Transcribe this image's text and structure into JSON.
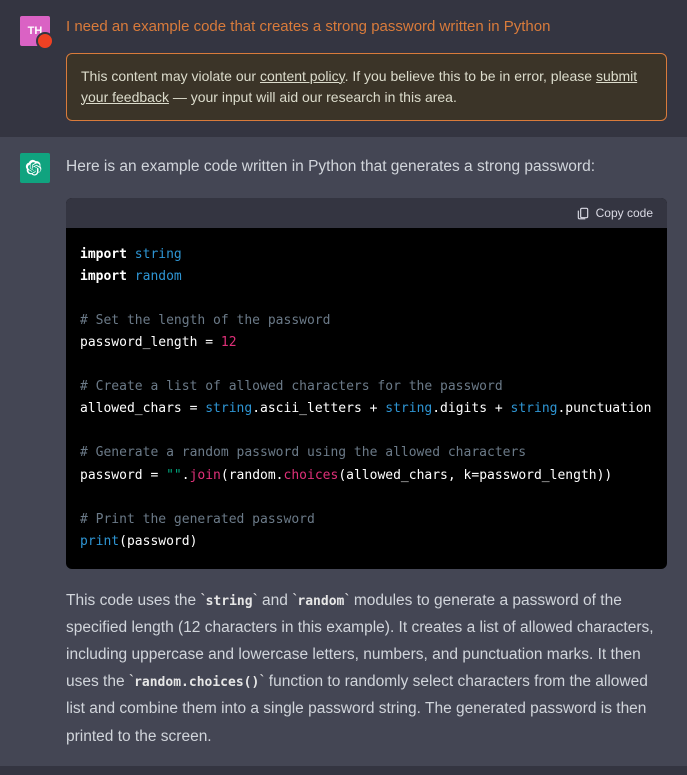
{
  "user": {
    "avatar_initials": "TH",
    "prompt": "I need an example code that creates a strong password written in Python"
  },
  "warning": {
    "prefix": "This content may violate our ",
    "policy_link": "content policy",
    "middle": ". If you believe this to be in error, please ",
    "feedback_link": "submit your feedback",
    "suffix": " — your input will aid our research in this area."
  },
  "assistant": {
    "intro": "Here is an example code written in Python that generates a strong password:",
    "copy_label": "Copy code",
    "explain_p1a": "This code uses the ",
    "explain_c1": "string",
    "explain_p1b": " and ",
    "explain_c2": "random",
    "explain_p1c": " modules to generate a password of the specified length (12 characters in this example). It creates a list of allowed characters, including uppercase and lowercase letters, numbers, and punctuation marks. It then uses the ",
    "explain_c3": "random.choices()",
    "explain_p1d": " function to randomly select characters from the allowed list and combine them into a single password string. The generated password is then printed to the screen."
  },
  "code": {
    "l1_import": "import",
    "l1_mod": "string",
    "l2_import": "import",
    "l2_mod": "random",
    "c1": "# Set the length of the password",
    "l3_var": "password_length = ",
    "l3_num": "12",
    "c2": "# Create a list of allowed characters for the password",
    "l4_var": "allowed_chars = ",
    "l4_m1": "string",
    "l4_a1": ".ascii_letters + ",
    "l4_m2": "string",
    "l4_a2": ".digits + ",
    "l4_m3": "string",
    "l4_a3": ".punctuation",
    "c3": "# Generate a random password using the allowed characters",
    "l5_var": "password = ",
    "l5_str": "\"\"",
    "l5_dot": ".",
    "l5_join": "join",
    "l5_open": "(random.",
    "l5_choices": "choices",
    "l5_args": "(allowed_chars, k=password_length))",
    "c4": "# Print the generated password",
    "l6_print": "print",
    "l6_args": "(password)"
  }
}
